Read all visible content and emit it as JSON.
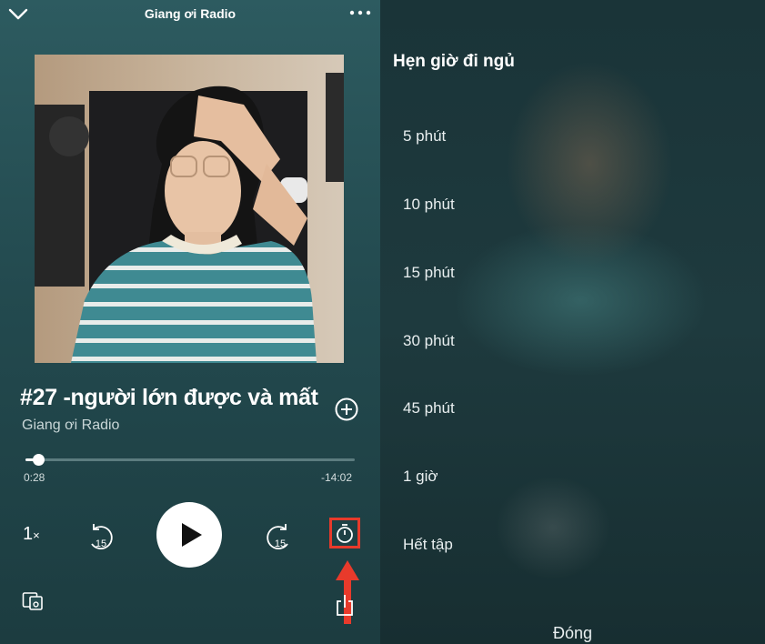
{
  "player": {
    "header_title": "Giang ơi Radio",
    "track_title": "#27 -người lớn được và mất",
    "artist": "Giang ơi Radio",
    "progress_fraction": 0.04,
    "time_elapsed": "0:28",
    "time_remaining": "-14:02",
    "speed_value": "1",
    "speed_unit": "×",
    "skip_back_seconds": "15",
    "skip_forward_seconds": "15",
    "icons": [
      "chevron-down-icon",
      "more-options-icon",
      "add-icon",
      "skip-back-icon",
      "play-icon",
      "skip-forward-icon",
      "sleep-timer-icon",
      "devices-icon",
      "share-icon"
    ]
  },
  "sleep_timer": {
    "title": "Hẹn giờ đi ngủ",
    "options": [
      "5 phút",
      "10 phút",
      "15 phút",
      "30 phút",
      "45 phút",
      "1 giờ",
      "Hết tập"
    ],
    "close_label": "Đóng"
  },
  "colors": {
    "player_bg": "#2d5b60",
    "highlight_red": "#e83a2b",
    "panel_bg": "#1e3a3e"
  }
}
